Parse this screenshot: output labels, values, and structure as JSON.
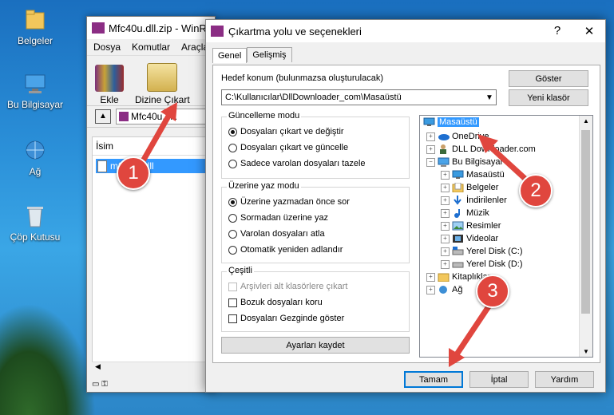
{
  "desktop": {
    "icons": [
      {
        "label": "Belgeler",
        "icon": "folder-icon"
      },
      {
        "label": "Bu Bilgisayar",
        "icon": "computer-icon"
      },
      {
        "label": "Ağ",
        "icon": "network-icon"
      },
      {
        "label": "Çöp Kutusu",
        "icon": "recycle-bin-icon"
      }
    ]
  },
  "winrar": {
    "title": "Mfc40u.dll.zip - WinR",
    "menu": [
      "Dosya",
      "Komutlar",
      "Araçla"
    ],
    "toolbar": {
      "add_label": "Ekle",
      "extract_label": "Dizine Çıkart"
    },
    "address": "Mfc40u.dll.",
    "column_header": "İsim",
    "file_name": "mfc40u.dll"
  },
  "dialog": {
    "title": "Çıkartma yolu ve seçenekleri",
    "help_symbol": "?",
    "close_symbol": "✕",
    "tabs": [
      "Genel",
      "Gelişmiş"
    ],
    "dest_label": "Hedef konum (bulunmazsa oluşturulacak)",
    "dest_value": "C:\\Kullanıcılar\\DllDownloader_com\\Masaüstü",
    "show_button": "Göster",
    "new_folder_button": "Yeni klasör",
    "update_mode": {
      "title": "Güncelleme modu",
      "options": [
        "Dosyaları çıkart ve değiştir",
        "Dosyaları çıkart ve güncelle",
        "Sadece varolan dosyaları tazele"
      ],
      "selected": 0
    },
    "overwrite_mode": {
      "title": "Üzerine yaz modu",
      "options": [
        "Üzerine yazmadan önce sor",
        "Sormadan üzerine yaz",
        "Varolan dosyaları atla",
        "Otomatik yeniden adlandır"
      ],
      "selected": 0
    },
    "misc": {
      "title": "Çeşitli",
      "options": [
        {
          "label": "Arşivleri alt klasörlere çıkart",
          "checked": false,
          "disabled": true
        },
        {
          "label": "Bozuk dosyaları koru",
          "checked": false,
          "disabled": false
        },
        {
          "label": "Dosyaları Gezginde göster",
          "checked": false,
          "disabled": false
        }
      ]
    },
    "save_settings_button": "Ayarları kaydet",
    "tree": [
      {
        "label": "Masaüstü",
        "level": 0,
        "icon": "desktop-icon",
        "selected": true
      },
      {
        "label": "OneDrive",
        "level": 1,
        "icon": "cloud-icon"
      },
      {
        "label": "DLL Downloader.com",
        "level": 1,
        "icon": "user-icon"
      },
      {
        "label": "Bu Bilgisayar",
        "level": 1,
        "icon": "computer-icon"
      },
      {
        "label": "Masaüstü",
        "level": 2,
        "icon": "desktop-icon"
      },
      {
        "label": "Belgeler",
        "level": 2,
        "icon": "documents-icon"
      },
      {
        "label": "İndirilenler",
        "level": 2,
        "icon": "download-icon"
      },
      {
        "label": "Müzik",
        "level": 2,
        "icon": "music-icon"
      },
      {
        "label": "Resimler",
        "level": 2,
        "icon": "pictures-icon"
      },
      {
        "label": "Videolar",
        "level": 2,
        "icon": "video-icon"
      },
      {
        "label": "Yerel Disk (C:)",
        "level": 2,
        "icon": "drive-icon"
      },
      {
        "label": "Yerel Disk (D:)",
        "level": 2,
        "icon": "drive-icon"
      },
      {
        "label": "Kitaplıklar",
        "level": 1,
        "icon": "library-icon"
      },
      {
        "label": "Ağ",
        "level": 1,
        "icon": "network-icon"
      }
    ],
    "ok_button": "Tamam",
    "cancel_button": "İptal",
    "help_button": "Yardım"
  },
  "annotations": [
    "1",
    "2",
    "3"
  ],
  "colors": {
    "selection": "#3399ff",
    "badge": "#e0463e",
    "default_button_border": "#0078d7"
  }
}
